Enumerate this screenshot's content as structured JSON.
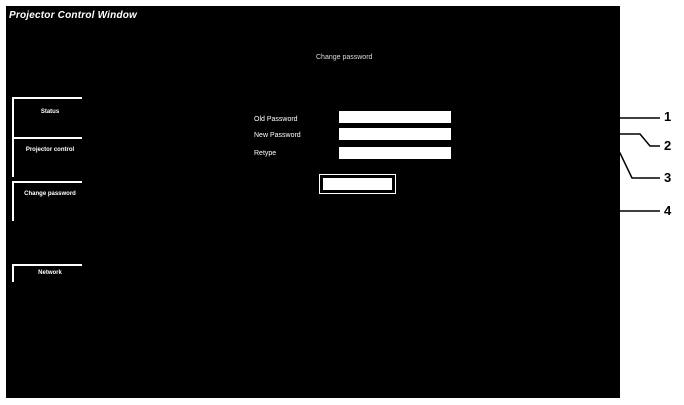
{
  "window": {
    "title": "Projector Control Window"
  },
  "page": {
    "heading": "Change password"
  },
  "nav": {
    "items": [
      {
        "label": "Status"
      },
      {
        "label": "Projector control"
      },
      {
        "label": "Change password"
      },
      {
        "label": "Network"
      }
    ]
  },
  "form": {
    "old_password_label": "Old Password",
    "new_password_label": "New Password",
    "retype_label": "Retype",
    "old_password_value": "",
    "new_password_value": "",
    "retype_value": "",
    "change_button_label": ""
  },
  "callouts": [
    "1",
    "2",
    "3",
    "4"
  ],
  "colors": {
    "window_bg": "#000000",
    "field_bg": "#ffffff",
    "page_bg": "#ffffff"
  }
}
